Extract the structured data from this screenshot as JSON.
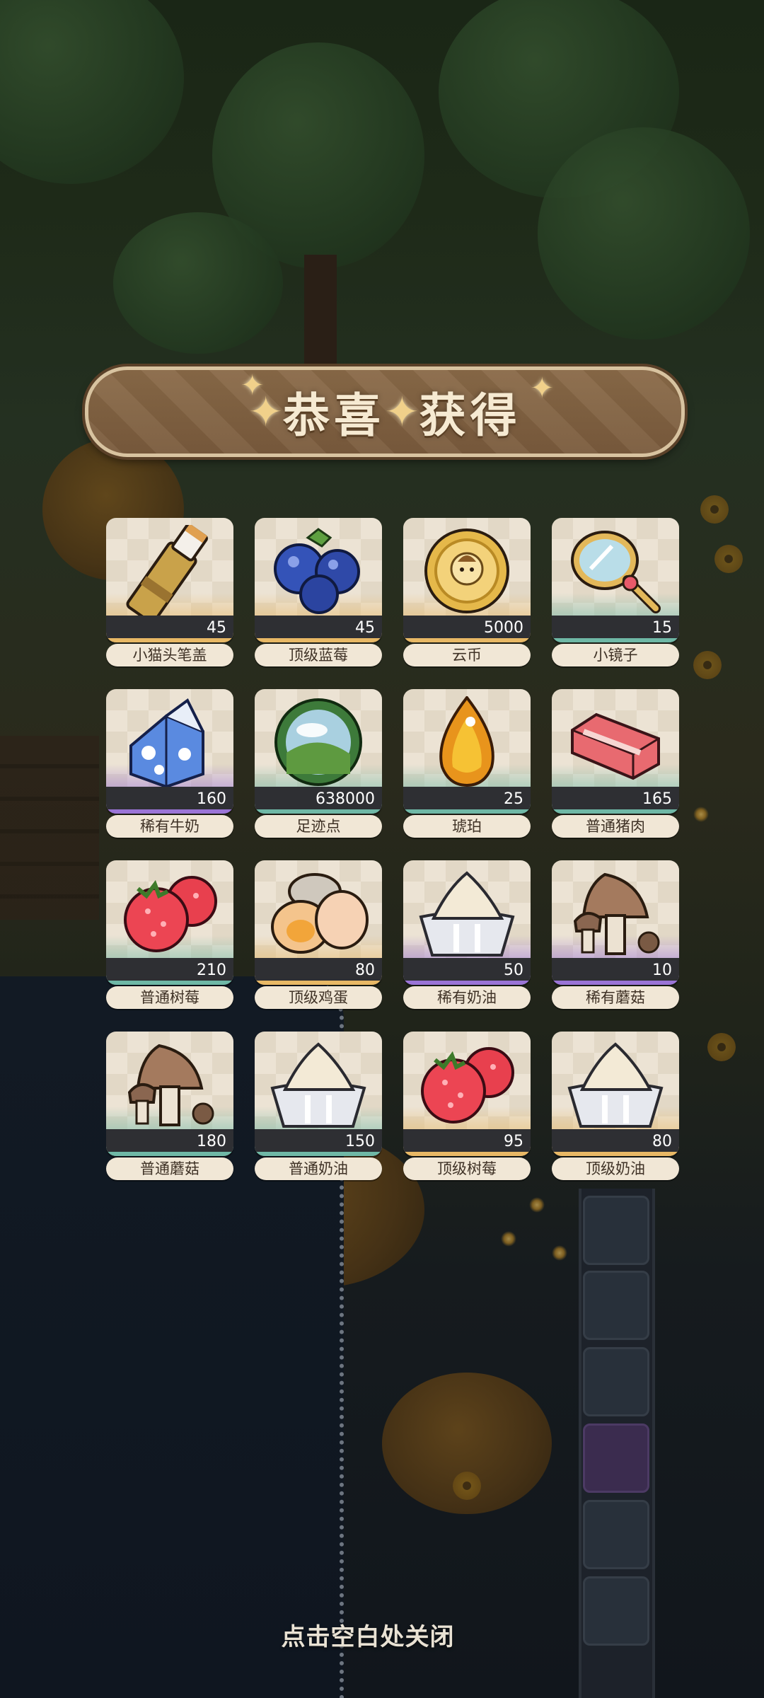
{
  "title": {
    "part1": "恭喜",
    "part2": "获得"
  },
  "rewards": [
    {
      "name": "小猫头笔盖",
      "count": "45",
      "icon": "brush-icon",
      "rarity": "gold"
    },
    {
      "name": "顶级蓝莓",
      "count": "45",
      "icon": "blueberry-icon",
      "rarity": "gold"
    },
    {
      "name": "云币",
      "count": "5000",
      "icon": "coin-icon",
      "rarity": "gold"
    },
    {
      "name": "小镜子",
      "count": "15",
      "icon": "mirror-icon",
      "rarity": "teal"
    },
    {
      "name": "稀有牛奶",
      "count": "160",
      "icon": "milk-carton-icon",
      "rarity": "purple"
    },
    {
      "name": "足迹点",
      "count": "638000",
      "icon": "footprint-orb-icon",
      "rarity": "teal"
    },
    {
      "name": "琥珀",
      "count": "25",
      "icon": "amber-icon",
      "rarity": "teal"
    },
    {
      "name": "普通猪肉",
      "count": "165",
      "icon": "pork-icon",
      "rarity": "teal"
    },
    {
      "name": "普通树莓",
      "count": "210",
      "icon": "raspberry-icon",
      "rarity": "teal"
    },
    {
      "name": "顶级鸡蛋",
      "count": "80",
      "icon": "eggs-icon",
      "rarity": "gold"
    },
    {
      "name": "稀有奶油",
      "count": "50",
      "icon": "cream-icon",
      "rarity": "purple"
    },
    {
      "name": "稀有蘑菇",
      "count": "10",
      "icon": "mushroom-icon",
      "rarity": "purple"
    },
    {
      "name": "普通蘑菇",
      "count": "180",
      "icon": "mushroom-icon",
      "rarity": "teal"
    },
    {
      "name": "普通奶油",
      "count": "150",
      "icon": "cream-icon",
      "rarity": "teal"
    },
    {
      "name": "顶级树莓",
      "count": "95",
      "icon": "raspberry-icon",
      "rarity": "gold"
    },
    {
      "name": "顶级奶油",
      "count": "80",
      "icon": "cream-icon",
      "rarity": "gold"
    }
  ],
  "close_hint": "点击空白处关闭",
  "colors": {
    "banner": "#7a5b3d",
    "gold_rarity": "#e8b865",
    "purple_rarity": "#9a74d6",
    "teal_rarity": "#6fb8a6"
  }
}
